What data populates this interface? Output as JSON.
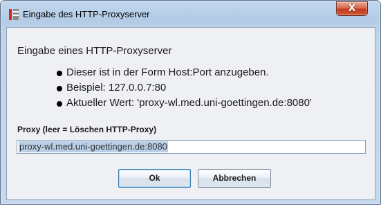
{
  "window": {
    "title": "Eingabe des HTTP-Proxyserver",
    "close_label": "X"
  },
  "dialog": {
    "heading": "Eingabe eines HTTP-Proxyserver",
    "bullets": [
      "Dieser ist in der Form Host:Port anzugeben.",
      "Beispiel: 127.0.0.7:80",
      "Aktueller Wert: 'proxy-wl.med.uni-goettingen.de:8080'"
    ],
    "proxy_label": "Proxy (leer = Löschen HTTP-Proxy)",
    "proxy_value": "proxy-wl.med.uni-goettingen.de:8080",
    "ok_label": "Ok",
    "cancel_label": "Abbrechen"
  },
  "colors": {
    "window_frame": "#c2d7ee",
    "client_bg": "#eef0f3",
    "close_button": "#c2381d",
    "app_icon_red": "#e2231a",
    "selection": "#b8cfe5"
  },
  "icons": {
    "app": "java-app-icon",
    "close": "close-icon"
  }
}
